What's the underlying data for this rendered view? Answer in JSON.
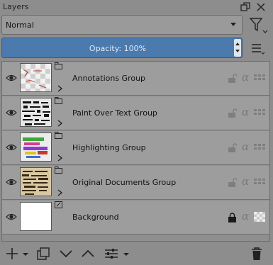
{
  "panel": {
    "title": "Layers"
  },
  "blend_mode": {
    "selected": "Normal"
  },
  "opacity": {
    "label": "Opacity:  100%",
    "value_percent": 100
  },
  "layers": [
    {
      "name": "Annotations Group",
      "thumb_icon": "checkerboard-thumb",
      "locked": false
    },
    {
      "name": "Paint Over Text Group",
      "thumb_icon": "text-scan-thumb",
      "locked": false
    },
    {
      "name": "Highlighting Group",
      "thumb_icon": "highlight-strokes-thumb",
      "locked": false
    },
    {
      "name": "Original Documents Group",
      "thumb_icon": "old-document-thumb",
      "locked": false
    },
    {
      "name": "Background",
      "thumb_icon": "white-thumb",
      "locked": true
    }
  ],
  "colors": {
    "accent": "#4a7aae",
    "panel": "#8d8d8d",
    "row": "#9d9d9d"
  }
}
